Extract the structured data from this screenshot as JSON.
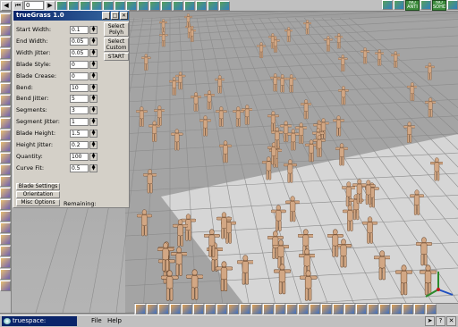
{
  "top_toolbar": {
    "frame_value": "0",
    "right_toggles": [
      "NO ANTI",
      "NO SOHD"
    ]
  },
  "panel": {
    "title": "trueGrass 1.0",
    "side_buttons": [
      "Select Polyh",
      "Select Custom",
      "START"
    ],
    "params": [
      {
        "label": "Start Width:",
        "value": "0.1"
      },
      {
        "label": "End Width:",
        "value": "0.05"
      },
      {
        "label": "Width Jitter:",
        "value": "0.05"
      },
      {
        "label": "Blade Style:",
        "value": "0"
      },
      {
        "label": "Blade Crease:",
        "value": "0"
      },
      {
        "label": "Bend:",
        "value": "10"
      },
      {
        "label": "Bend Jitter:",
        "value": "5"
      },
      {
        "label": "Segments:",
        "value": "3"
      },
      {
        "label": "Segment Jitter:",
        "value": "1"
      },
      {
        "label": "Blade Height:",
        "value": "1.5"
      },
      {
        "label": "Height Jitter:",
        "value": "0.2"
      },
      {
        "label": "Quantity:",
        "value": "100"
      },
      {
        "label": "Curve Fit:",
        "value": "0.5"
      }
    ],
    "bottom_buttons": [
      "Blade Settings",
      "Orientation",
      "Misc Options"
    ],
    "remaining_label": "Remaining:"
  },
  "status_bar": {
    "app_title": "truespace: newscene",
    "menu": [
      "File",
      "Help"
    ]
  },
  "colors": {
    "title_bar": "#0a246a",
    "figure_skin": "#d2a784",
    "floor": "#d6d6d6"
  }
}
